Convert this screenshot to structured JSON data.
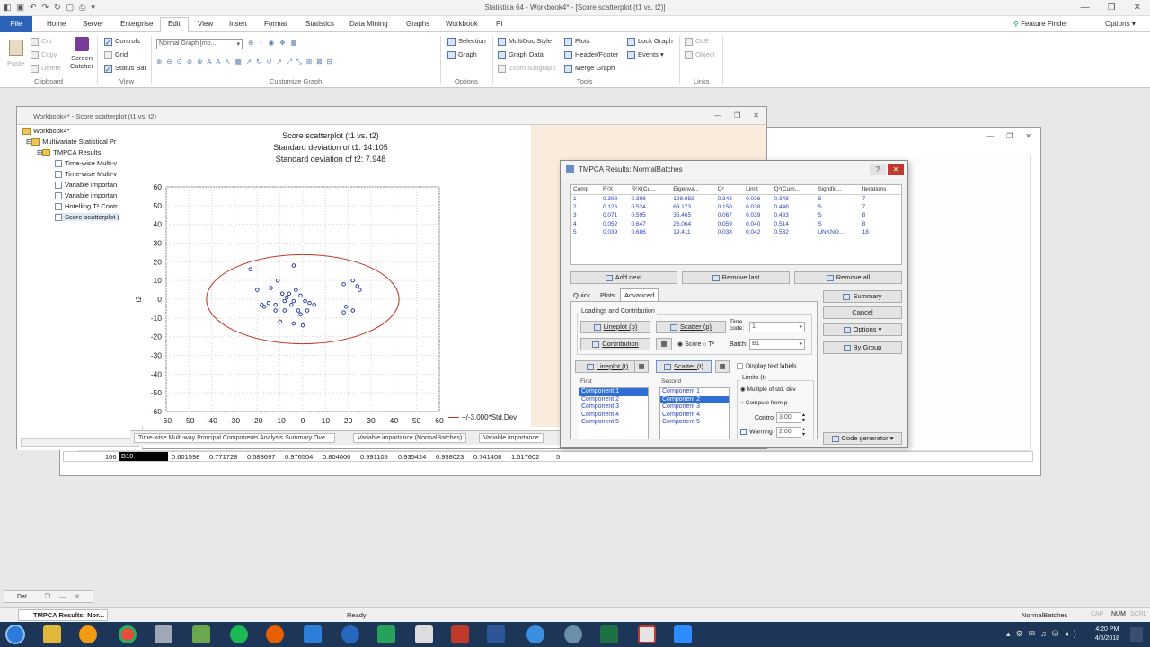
{
  "app": {
    "title": "Statistica 64 - Workbook4* - [Score scatterplot (t1 vs. t2)]"
  },
  "menu": {
    "file": "File",
    "items": [
      "Home",
      "Server",
      "Enterprise",
      "Edit",
      "View",
      "Insert",
      "Format",
      "Statistics",
      "Data Mining",
      "Graphs",
      "Workbook",
      "PI"
    ],
    "active": "Edit",
    "feature_finder": "Feature Finder",
    "options": "Options"
  },
  "ribbon": {
    "clipboard": {
      "paste": "Paste",
      "cut": "Cut",
      "copy": "Copy",
      "delete": "Delete",
      "screen_catcher": "Screen Catcher",
      "label": "Clipboard"
    },
    "view": {
      "controls": "Controls",
      "grid": "Grid",
      "status_bar": "Status Bar",
      "label": "View"
    },
    "customize": {
      "graph_mode": "Normal Graph [mo...",
      "label": "Customize Graph"
    },
    "options": {
      "selection": "Selection",
      "graph": "Graph",
      "label": "Options"
    },
    "tools": {
      "multidoc": "MultiDoc Style",
      "graph_data": "Graph Data",
      "zoom_subgraph": "Zoom subgraph",
      "plots": "Plots",
      "header_footer": "Header/Footer",
      "merge_graph": "Merge Graph",
      "lock_graph": "Lock Graph",
      "events": "Events",
      "label": "Tools"
    },
    "links": {
      "ole": "OLE",
      "object": "Object",
      "label": "Links"
    }
  },
  "workbook": {
    "title": "Workbook4* - Score scatterplot (t1 vs. t2)",
    "tree": [
      {
        "label": "Workbook4*",
        "type": "folder"
      },
      {
        "label": "Multivariate Statistical Pr",
        "type": "folder"
      },
      {
        "label": "TMPCA Results",
        "type": "folder"
      },
      {
        "label": "Time-wise Multi-v",
        "type": "doc"
      },
      {
        "label": "Time-wise Multi-v",
        "type": "doc"
      },
      {
        "label": "Variable importan",
        "type": "doc"
      },
      {
        "label": "Variable importan",
        "type": "doc"
      },
      {
        "label": "Hotelling T² Contr",
        "type": "doc"
      },
      {
        "label": "Score scatterplot (",
        "type": "doc"
      }
    ],
    "tabs": [
      "Time-wise Multi-way Principal Components Analysis Summary Ove...",
      "Variable importance (NormalBatches)",
      "Variable importance"
    ]
  },
  "chart_data": {
    "type": "scatter",
    "title": "Score scatterplot (t1 vs. t2)",
    "subtitle1": "Standard deviation of t1: 14.105",
    "subtitle2": "Standard deviation of t2: 7.948",
    "xlabel": "t1",
    "ylabel": "t2",
    "xlim": [
      -60,
      60
    ],
    "ylim": [
      -60,
      60
    ],
    "xticks": [
      "-60",
      "-50",
      "-40",
      "-30",
      "-20",
      "-10",
      "0",
      "10",
      "20",
      "30",
      "40",
      "50",
      "60"
    ],
    "yticks": [
      "60",
      "50",
      "40",
      "30",
      "20",
      "10",
      "0",
      "-10",
      "-20",
      "-30",
      "-40",
      "-50",
      "-60"
    ],
    "grid": true,
    "legend": "+/-3.000*Std.Dev",
    "legend_position": "bottom-right",
    "ellipse": {
      "rx": 42.3,
      "ry": 23.8,
      "color": "#c0392b"
    },
    "point_color": "#1f2f9a",
    "points": [
      [
        -23,
        16
      ],
      [
        -11,
        10
      ],
      [
        -4,
        18
      ],
      [
        -20,
        5
      ],
      [
        -14,
        6
      ],
      [
        -9,
        3
      ],
      [
        -7,
        1
      ],
      [
        -6,
        3
      ],
      [
        -4,
        -1
      ],
      [
        -3,
        5
      ],
      [
        -1,
        2
      ],
      [
        -8,
        -1
      ],
      [
        -5,
        -3
      ],
      [
        1,
        -1
      ],
      [
        3,
        -2
      ],
      [
        -2,
        -6
      ],
      [
        -1,
        -8
      ],
      [
        -10,
        -12
      ],
      [
        -4,
        -13
      ],
      [
        0,
        -14
      ],
      [
        -15,
        -2
      ],
      [
        -18,
        -3
      ],
      [
        -17,
        -4
      ],
      [
        -12,
        -3
      ],
      [
        5,
        -3
      ],
      [
        2,
        -6
      ],
      [
        18,
        8
      ],
      [
        22,
        10
      ],
      [
        25,
        5
      ],
      [
        24,
        7
      ],
      [
        19,
        -4
      ],
      [
        22,
        -6
      ],
      [
        18,
        -7
      ],
      [
        -8,
        -6
      ],
      [
        -12,
        -6
      ]
    ]
  },
  "dialog": {
    "title": "TMPCA Results: NormalBatches",
    "help": "?",
    "close": "✕",
    "table": {
      "headers": [
        "Comp",
        "R²X",
        "R²X(Cu...",
        "Eigenva...",
        "Q²",
        "Limit",
        "Q²(Cum...",
        "Signific...",
        "Iterations"
      ],
      "rows": [
        [
          "1",
          "0.398",
          "0.398",
          "198.959",
          "0.348",
          "0.036",
          "0.348",
          "S",
          "7"
        ],
        [
          "2",
          "0.126",
          "0.524",
          "63.173",
          "0.150",
          "0.038",
          "0.446",
          "S",
          "7"
        ],
        [
          "3",
          "0.071",
          "0.595",
          "35.465",
          "0.067",
          "0.039",
          "0.483",
          "S",
          "8"
        ],
        [
          "4",
          "0.052",
          "0.647",
          "26.064",
          "0.059",
          "0.040",
          "0.514",
          "S",
          "8"
        ],
        [
          "5",
          "0.039",
          "0.686",
          "19.411",
          "0.038",
          "0.042",
          "0.532",
          "UNKNO...",
          "18"
        ]
      ]
    },
    "buttons": {
      "add_next": "Add next",
      "remove_last": "Remove last",
      "remove_all": "Remove all",
      "summary": "Summary",
      "cancel": "Cancel",
      "options": "Options",
      "by_group": "By Group",
      "code_generator": "Code generator"
    },
    "tabs": [
      "Quick",
      "Plots",
      "Advanced"
    ],
    "active_tab": "Advanced",
    "loadings": {
      "label": "Loadings and Contribution",
      "lineplot_p": "Lineplot (p)",
      "scatter_p": "Scatter (p)",
      "contribution": "Contribution",
      "time_code_label": "Time code:",
      "time_code_value": "1",
      "score_label": "Score",
      "t2_label": "T²",
      "batch_label": "Batch:",
      "batch_value": "B1"
    },
    "lineplot_t": "Lineplot (t)",
    "scatter_t": "Scatter (t)",
    "display_text_labels": "Display text labels",
    "first_label": "First",
    "second_label": "Second",
    "components": [
      "Component 1",
      "Component 2",
      "Component 3",
      "Component 4",
      "Component 5"
    ],
    "first_selected": 0,
    "second_selected": 1,
    "limits": {
      "label": "Limits (t)",
      "multiple": "Multiple of std. dev",
      "compute": "Compute from p",
      "control_label": "Control",
      "control_value": "3.00",
      "warning_label": "Warning",
      "warning_value": "2.00"
    }
  },
  "data_row": {
    "row_id": "106",
    "selected": "B10",
    "values": [
      "0.601598",
      "0.771728",
      "0.583697",
      "0.976504",
      "0.804000",
      "0.991105",
      "0.935424",
      "0.958023",
      "0.741408",
      "1.517602"
    ],
    "tail": "5"
  },
  "status": {
    "ready": "Ready",
    "batches": "NormalBatches",
    "cap": "CAP",
    "num": "NUM",
    "scrl": "SCRL",
    "mini_tab": "Dat...",
    "task_window": "TMPCA Results: Nor..."
  },
  "clock": {
    "time": "4:20 PM",
    "date": "4/5/2018"
  }
}
